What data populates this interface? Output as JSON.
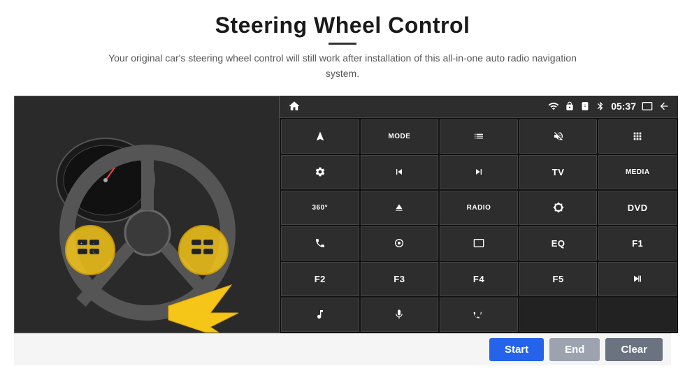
{
  "header": {
    "title": "Steering Wheel Control",
    "subtitle": "Your original car's steering wheel control will still work after installation of this all-in-one auto radio navigation system."
  },
  "status_bar": {
    "time": "05:37",
    "icons": [
      "wifi",
      "lock",
      "sim",
      "bluetooth",
      "screen",
      "back"
    ]
  },
  "buttons": [
    {
      "id": "nav",
      "icon": "⬆",
      "type": "icon"
    },
    {
      "id": "mode",
      "label": "MODE",
      "type": "text"
    },
    {
      "id": "list",
      "icon": "☰",
      "type": "icon"
    },
    {
      "id": "mute",
      "icon": "🔇",
      "type": "icon"
    },
    {
      "id": "apps",
      "icon": "⊞",
      "type": "icon"
    },
    {
      "id": "settings",
      "icon": "⚙",
      "type": "icon"
    },
    {
      "id": "prev",
      "icon": "⏮",
      "type": "icon"
    },
    {
      "id": "next",
      "icon": "⏭",
      "type": "icon"
    },
    {
      "id": "tv",
      "label": "TV",
      "type": "text"
    },
    {
      "id": "media",
      "label": "MEDIA",
      "type": "text"
    },
    {
      "id": "360",
      "icon": "360°",
      "type": "icon"
    },
    {
      "id": "eject",
      "icon": "⏏",
      "type": "icon"
    },
    {
      "id": "radio",
      "label": "RADIO",
      "type": "text"
    },
    {
      "id": "brightness",
      "icon": "☀",
      "type": "icon"
    },
    {
      "id": "dvd",
      "label": "DVD",
      "type": "text"
    },
    {
      "id": "phone",
      "icon": "📞",
      "type": "icon"
    },
    {
      "id": "menu",
      "icon": "◎",
      "type": "icon"
    },
    {
      "id": "window",
      "icon": "▭",
      "type": "icon"
    },
    {
      "id": "eq",
      "label": "EQ",
      "type": "text"
    },
    {
      "id": "f1",
      "label": "F1",
      "type": "text"
    },
    {
      "id": "f2",
      "label": "F2",
      "type": "text"
    },
    {
      "id": "f3",
      "label": "F3",
      "type": "text"
    },
    {
      "id": "f4",
      "label": "F4",
      "type": "text"
    },
    {
      "id": "f5",
      "label": "F5",
      "type": "text"
    },
    {
      "id": "playpause",
      "icon": "▶⏸",
      "type": "icon"
    },
    {
      "id": "music",
      "icon": "♫",
      "type": "icon"
    },
    {
      "id": "mic",
      "icon": "🎤",
      "type": "icon"
    },
    {
      "id": "volphone",
      "icon": "🔊/📞",
      "type": "icon"
    },
    {
      "id": "empty1",
      "label": "",
      "type": "empty"
    },
    {
      "id": "empty2",
      "label": "",
      "type": "empty"
    }
  ],
  "bottom_bar": {
    "start_label": "Start",
    "end_label": "End",
    "clear_label": "Clear"
  }
}
